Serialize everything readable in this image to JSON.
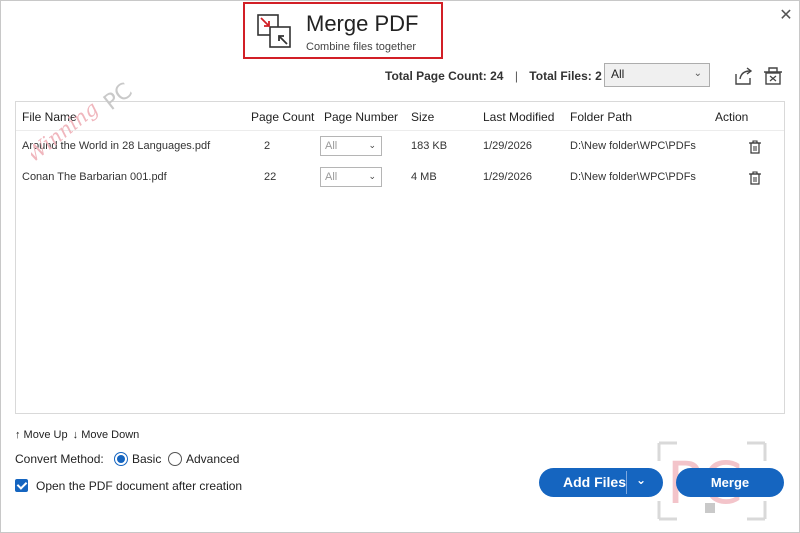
{
  "window": {
    "close_glyph": "✕"
  },
  "header": {
    "title": "Merge PDF",
    "subtitle": "Combine files together"
  },
  "summary": {
    "page_count_label": "Total Page Count:",
    "page_count_value": "24",
    "separator": "|",
    "files_label": "Total Files:",
    "files_value": "2"
  },
  "filter": {
    "selected": "All",
    "caret": "⌄"
  },
  "table": {
    "columns": [
      "File Name",
      "Page Count",
      "Page Number",
      "Size",
      "Last Modified",
      "Folder Path",
      "Action"
    ],
    "rows": [
      {
        "file_name": "Around the World in 28 Languages.pdf",
        "page_count": "2",
        "page_number": "All",
        "size": "183 KB",
        "last_modified": "1/29/2026",
        "folder_path": "D:\\New folder\\WPC\\PDFs"
      },
      {
        "file_name": "Conan The Barbarian 001.pdf",
        "page_count": "22",
        "page_number": "All",
        "size": "4 MB",
        "last_modified": "1/29/2026",
        "folder_path": "D:\\New folder\\WPC\\PDFs"
      }
    ]
  },
  "watermark": {
    "text_main": "Winning",
    "text_pc": "PC"
  },
  "controls": {
    "move_up": "↑ Move Up",
    "move_down": "↓ Move Down",
    "convert_label": "Convert Method:",
    "basic": "Basic",
    "advanced": "Advanced",
    "selected_method": "Basic",
    "open_after": "Open the PDF document after creation",
    "open_after_checked": true
  },
  "buttons": {
    "add_files": "Add Files",
    "add_caret": "⌄",
    "merge": "Merge"
  },
  "colors": {
    "accent": "#1565c0",
    "header_border": "#d21f26",
    "watermark": "#f0b6bd"
  }
}
